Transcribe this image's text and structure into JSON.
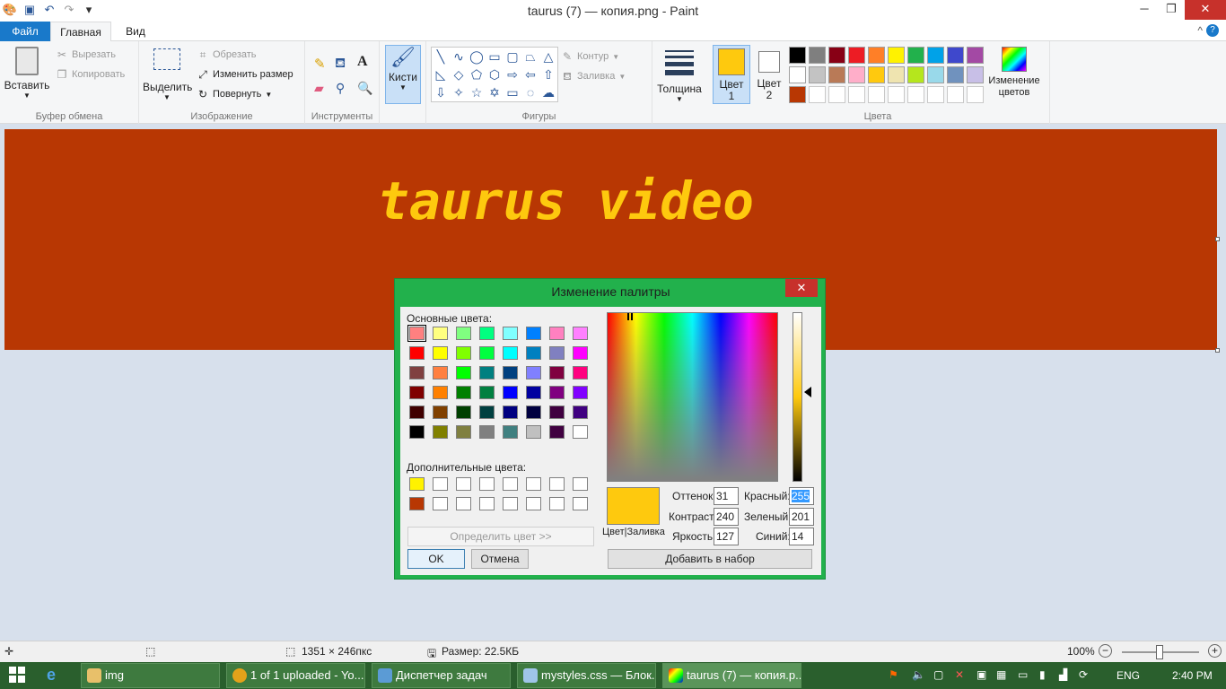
{
  "window": {
    "title": "taurus (7) — копия.png - Paint",
    "minimize": "─",
    "maximize": "❐",
    "close": "✕"
  },
  "qat": {
    "undo": "↶",
    "redo": "↷",
    "more": "▾",
    "help": "?",
    "collapse": "^"
  },
  "tabs": [
    {
      "label": "Файл"
    },
    {
      "label": "Главная"
    },
    {
      "label": "Вид"
    }
  ],
  "ribbon": {
    "clipboard": {
      "label": "Буфер обмена",
      "paste": "Вставить",
      "cut": "Вырезать",
      "copy": "Копировать"
    },
    "image": {
      "label": "Изображение",
      "select": "Выделить",
      "crop": "Обрезать",
      "resize": "Изменить размер",
      "rotate": "Повернуть"
    },
    "tools": {
      "label": "Инструменты"
    },
    "brushes": {
      "label": "Кисти"
    },
    "shapes": {
      "label": "Фигуры",
      "outline": "Контур",
      "fill": "Заливка"
    },
    "size": {
      "label": "Толщина"
    },
    "colors": {
      "label": "Цвета",
      "color1": "Цвет 1",
      "color2": "Цвет 2",
      "edit": "Изменение цветов",
      "color1_value": "#fec90e",
      "color2_value": "#ffffff",
      "palette": [
        "#000000",
        "#7f7f7f",
        "#880015",
        "#ed1c24",
        "#ff7f27",
        "#fff200",
        "#22b14c",
        "#00a2e8",
        "#3f48cc",
        "#a349a4",
        "#ffffff",
        "#c3c3c3",
        "#b97a57",
        "#ffaec9",
        "#ffc90e",
        "#efe4b0",
        "#b5e61d",
        "#99d9ea",
        "#7092be",
        "#c8bfe7",
        "#b83703",
        "#ffffff",
        "#ffffff",
        "#ffffff",
        "#ffffff",
        "#ffffff",
        "#ffffff",
        "#ffffff",
        "#ffffff",
        "#ffffff"
      ]
    }
  },
  "canvas": {
    "text": "taurus video",
    "bg": "#b83703",
    "text_color": "#fec90e"
  },
  "dialog": {
    "title": "Изменение палитры",
    "basic_label": "Основные цвета:",
    "custom_label": "Дополнительные цвета:",
    "define_button": "Определить цвет >>",
    "ok": "OK",
    "cancel": "Отмена",
    "add_button": "Добавить в набор",
    "preview_label": "Цвет|Заливка",
    "hue_label": "Оттенок:",
    "hue": "31",
    "sat_label": "Контраст:",
    "sat": "240",
    "lum_label": "Яркость:",
    "lum": "127",
    "red_label": "Красный:",
    "red": "255",
    "green_label": "Зеленый:",
    "green": "201",
    "blue_label": "Синий:",
    "blue": "14",
    "basic_colors": [
      "#ff8080",
      "#ffff80",
      "#80ff80",
      "#00ff80",
      "#80ffff",
      "#0080ff",
      "#ff80c0",
      "#ff80ff",
      "#ff0000",
      "#ffff00",
      "#80ff00",
      "#00ff40",
      "#00ffff",
      "#0080c0",
      "#8080c0",
      "#ff00ff",
      "#804040",
      "#ff8040",
      "#00ff00",
      "#008080",
      "#004080",
      "#8080ff",
      "#800040",
      "#ff0080",
      "#800000",
      "#ff8000",
      "#008000",
      "#008040",
      "#0000ff",
      "#0000a0",
      "#800080",
      "#8000ff",
      "#400000",
      "#804000",
      "#004000",
      "#004040",
      "#000080",
      "#000040",
      "#400040",
      "#400080",
      "#000000",
      "#808000",
      "#808040",
      "#808080",
      "#408080",
      "#c0c0c0",
      "#400040",
      "#ffffff"
    ],
    "custom_colors": [
      "#fff200",
      "#ffffff",
      "#ffffff",
      "#ffffff",
      "#ffffff",
      "#ffffff",
      "#ffffff",
      "#ffffff",
      "#b83703",
      "#ffffff",
      "#ffffff",
      "#ffffff",
      "#ffffff",
      "#ffffff",
      "#ffffff",
      "#ffffff"
    ]
  },
  "status": {
    "dimensions": "1351 × 246пкс",
    "size": "Размер: 22.5КБ",
    "zoom": "100%"
  },
  "taskbar": {
    "items": [
      {
        "label": "img"
      },
      {
        "label": "1 of 1 uploaded - Yo..."
      },
      {
        "label": "Диспетчер задач"
      },
      {
        "label": "mystyles.css — Блок..."
      },
      {
        "label": "taurus (7) — копия.p..."
      }
    ],
    "lang": "ENG",
    "time": "2:40 PM"
  }
}
